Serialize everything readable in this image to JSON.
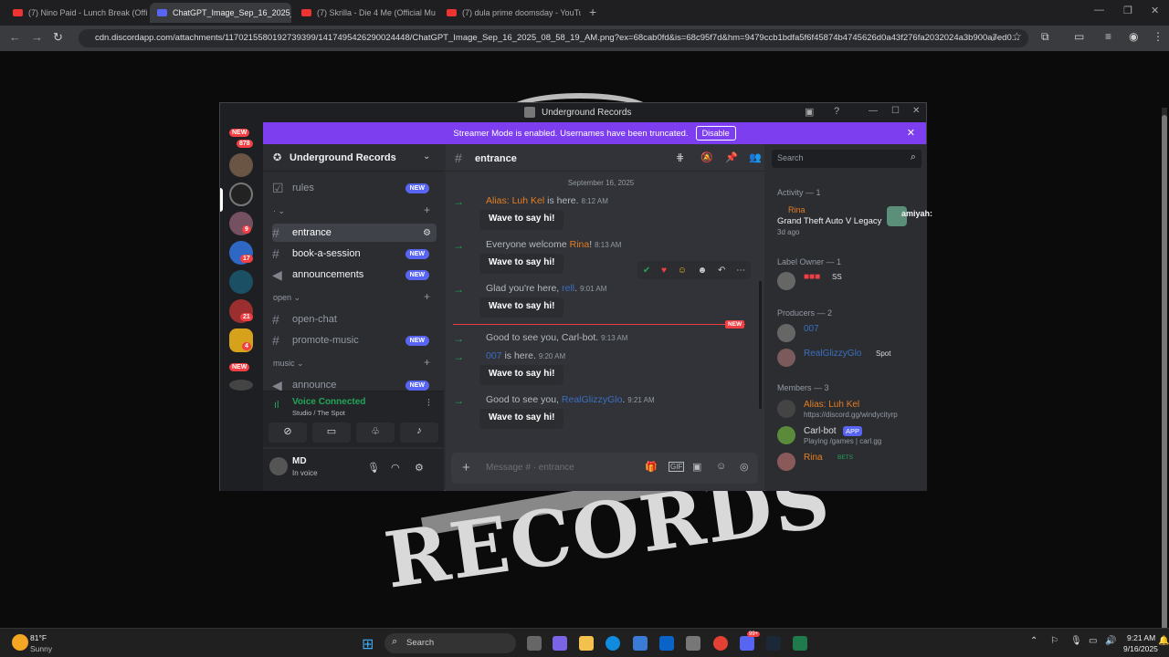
{
  "browser": {
    "tabs": [
      {
        "title": "(7) Nino Paid - Lunch Break (Offic",
        "active": false
      },
      {
        "title": "ChatGPT_Image_Sep_16_2025_08",
        "active": true
      },
      {
        "title": "(7) Skrilla - Die 4 Me (Official Mu",
        "active": false
      },
      {
        "title": "(7) dula prime doomsday - YouTu",
        "active": false
      }
    ],
    "url": "cdn.discordapp.com/attachments/1170215580192739399/1417495426290024448/ChatGPT_Image_Sep_16_2025_08_58_19_AM.png?ex=68cab0fd&is=68c95f7d&hm=9479ccb1bdfa5f6f45874b4745626d0a43f276fa2032024a3b900a7ed0..."
  },
  "background": {
    "records_text": "RECORDS"
  },
  "discord": {
    "window_title": "Underground Records",
    "banner": {
      "text": "Streamer Mode is enabled. Usernames have been truncated.",
      "button": "Disable"
    },
    "server": {
      "name": "Underground Records"
    },
    "guild_badges": {
      "new_top": "NEW",
      "b1": "878",
      "b2": "9",
      "b3": "17",
      "b4": "21",
      "b5": "4",
      "new_bottom": "NEW"
    },
    "channels": {
      "rules": "rules",
      "entrance": "entrance",
      "book": "book-a-session",
      "announcements": "announcements",
      "cat_open": "open",
      "open_chat": "open-chat",
      "promote": "promote-music",
      "cat_music": "music",
      "announce": "announce",
      "new_label": "NEW"
    },
    "voice": {
      "status": "Voice Connected",
      "location": "Studio / The Spot"
    },
    "user": {
      "name": "MD",
      "status": "In voice"
    },
    "chat": {
      "channel": "entrance",
      "date_divider": "September 16, 2025",
      "new_divider": "NEW",
      "messages": [
        {
          "pre": "Alias: Luh Kel",
          "post": " is here.",
          "time": "8:12 AM",
          "wave": "Wave to say hi!"
        },
        {
          "pre": "Everyone welcome ",
          "name": "Rina",
          "post": "!",
          "time": "8:13 AM",
          "wave": "Wave to say hi!"
        },
        {
          "pre": "Glad you're here, ",
          "name": "rell",
          "post": ".",
          "time": "9:01 AM",
          "wave": "Wave to say hi!"
        },
        {
          "pre": "Good to see you, Carl-bot.",
          "time": "9:13 AM"
        },
        {
          "name": "007",
          "post": " is here.",
          "time": "9:20 AM",
          "wave": "Wave to say hi!"
        },
        {
          "pre": "Good to see you, ",
          "name": "RealGlizzyGlo",
          "post": ".",
          "time": "9:21 AM",
          "wave": "Wave to say hi!"
        }
      ],
      "input_placeholder": "Message # · entrance",
      "search_placeholder": "Search"
    },
    "members": {
      "activity_header": "Activity — 1",
      "activity_name": "Rina",
      "activity_game": "Grand Theft Auto V Legacy",
      "activity_time": "3d ago",
      "overlay_name": "amiyah:",
      "label_owner_header": "Label Owner — 1",
      "owner_tag": "SS",
      "producers_header": "Producers — 2",
      "producer1": "007",
      "producer2": "RealGlizzyGlo",
      "producer2_tag": "Spot",
      "members_header": "Members — 3",
      "m1": "Alias: Luh Kel",
      "m1_sub": "https://discord.gg/windycityrp",
      "m2": "Carl-bot",
      "m2_tag": "APP",
      "m2_sub": "Playing /games | carl.gg",
      "m3": "Rina",
      "m3_tag": "BETS"
    }
  },
  "taskbar": {
    "temp": "81°F",
    "weather": "Sunny",
    "search": "Search",
    "time": "9:21 AM",
    "date": "9/16/2025",
    "badge": "99+"
  }
}
